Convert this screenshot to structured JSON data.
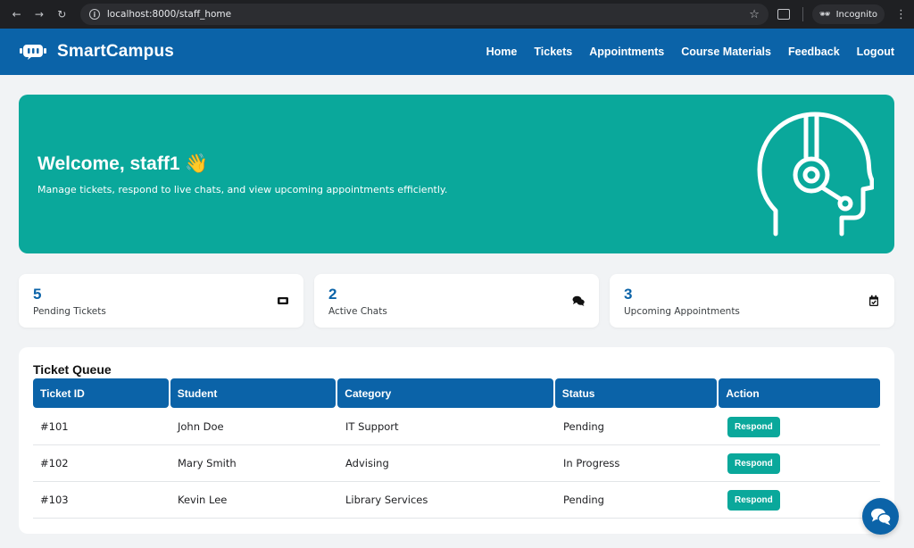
{
  "browser": {
    "url": "localhost:8000/staff_home",
    "profile_label": "Incognito"
  },
  "navbar": {
    "brand": "SmartCampus",
    "links": [
      "Home",
      "Tickets",
      "Appointments",
      "Course Materials",
      "Feedback",
      "Logout"
    ]
  },
  "hero": {
    "title": "Welcome, staff1 👋",
    "subtitle": "Manage tickets, respond to live chats, and view upcoming appointments efficiently.",
    "icon": "headset-support-icon"
  },
  "stats": [
    {
      "value": "5",
      "label": "Pending Tickets",
      "icon": "ticket-icon"
    },
    {
      "value": "2",
      "label": "Active Chats",
      "icon": "chat-icon"
    },
    {
      "value": "3",
      "label": "Upcoming Appointments",
      "icon": "calendar-icon"
    }
  ],
  "queue": {
    "title": "Ticket Queue",
    "headers": [
      "Ticket ID",
      "Student",
      "Category",
      "Status",
      "Action"
    ],
    "rows": [
      {
        "id": "#101",
        "student": "John Doe",
        "category": "IT Support",
        "status": "Pending",
        "action": "Respond"
      },
      {
        "id": "#102",
        "student": "Mary Smith",
        "category": "Advising",
        "status": "In Progress",
        "action": "Respond"
      },
      {
        "id": "#103",
        "student": "Kevin Lee",
        "category": "Library Services",
        "status": "Pending",
        "action": "Respond"
      }
    ]
  },
  "colors": {
    "primary": "#0b63a8",
    "accent": "#0aa89b",
    "background": "#f1f3f5"
  }
}
